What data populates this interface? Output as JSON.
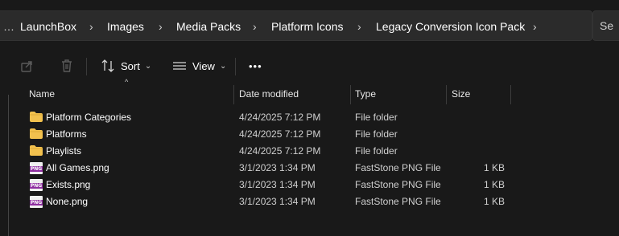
{
  "breadcrumb": {
    "overflow": "…",
    "items": [
      "LaunchBox",
      "Images",
      "Media Packs",
      "Platform Icons",
      "Legacy Conversion Icon Pack"
    ]
  },
  "search": {
    "placeholder": "Se"
  },
  "toolbar": {
    "share_icon": "share-icon",
    "delete_icon": "trash-icon",
    "sort_label": "Sort",
    "view_label": "View",
    "more_label": "•••"
  },
  "columns": {
    "name": "Name",
    "date": "Date modified",
    "type": "Type",
    "size": "Size"
  },
  "files": [
    {
      "name": "Platform Categories",
      "date": "4/24/2025 7:12 PM",
      "type": "File folder",
      "size": "",
      "icon": "folder-icon"
    },
    {
      "name": "Platforms",
      "date": "4/24/2025 7:12 PM",
      "type": "File folder",
      "size": "",
      "icon": "folder-icon"
    },
    {
      "name": "Playlists",
      "date": "4/24/2025 7:12 PM",
      "type": "File folder",
      "size": "",
      "icon": "folder-icon"
    },
    {
      "name": "All Games.png",
      "date": "3/1/2023 1:34 PM",
      "type": "FastStone PNG File",
      "size": "1 KB",
      "icon": "png-file-icon"
    },
    {
      "name": "Exists.png",
      "date": "3/1/2023 1:34 PM",
      "type": "FastStone PNG File",
      "size": "1 KB",
      "icon": "png-file-icon"
    },
    {
      "name": "None.png",
      "date": "3/1/2023 1:34 PM",
      "type": "FastStone PNG File",
      "size": "1 KB",
      "icon": "png-file-icon"
    }
  ],
  "png_tag": "PNG",
  "colors": {
    "background": "#191919",
    "bar": "#2b2b2b",
    "folder": "#f2c14e",
    "png_tag": "#8e2ea0"
  }
}
